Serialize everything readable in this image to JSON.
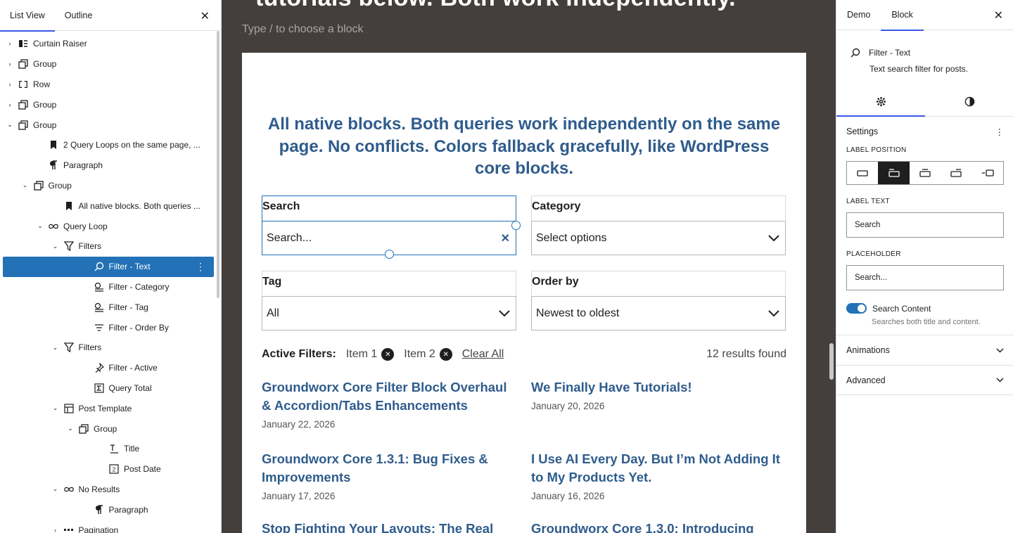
{
  "left_panel": {
    "tabs": [
      "List View",
      "Outline"
    ],
    "close_label": "✕",
    "tree": [
      {
        "label": "Curtain Raiser",
        "chev": "›",
        "indent": 0,
        "icon": "curtain-icon"
      },
      {
        "label": "Group",
        "chev": "›",
        "indent": 0,
        "icon": "group-icon"
      },
      {
        "label": "Row",
        "chev": "›",
        "indent": 0,
        "icon": "row-icon"
      },
      {
        "label": "Group",
        "chev": "›",
        "indent": 0,
        "icon": "group-icon"
      },
      {
        "label": "Group",
        "chev": "⌄",
        "indent": 0,
        "icon": "group-icon"
      },
      {
        "label": "2 Query Loops on the same page, ...",
        "chev": "",
        "indent": 2,
        "icon": "bookmark-icon"
      },
      {
        "label": "Paragraph",
        "chev": "",
        "indent": 2,
        "icon": "paragraph-icon"
      },
      {
        "label": "Group",
        "chev": "⌄",
        "indent": 1,
        "icon": "group-icon"
      },
      {
        "label": "All native blocks. Both queries ...",
        "chev": "",
        "indent": 3,
        "icon": "bookmark-icon"
      },
      {
        "label": "Query Loop",
        "chev": "⌄",
        "indent": 2,
        "icon": "loop-icon"
      },
      {
        "label": "Filters",
        "chev": "⌄",
        "indent": 3,
        "icon": "funnel-icon"
      },
      {
        "label": "Filter - Text",
        "chev": "",
        "indent": 5,
        "icon": "search-icon",
        "selected": true
      },
      {
        "label": "Filter - Category",
        "chev": "",
        "indent": 5,
        "icon": "filter-select-icon"
      },
      {
        "label": "Filter - Tag",
        "chev": "",
        "indent": 5,
        "icon": "filter-select-icon"
      },
      {
        "label": "Filter - Order By",
        "chev": "",
        "indent": 5,
        "icon": "sort-icon"
      },
      {
        "label": "Filters",
        "chev": "⌄",
        "indent": 3,
        "icon": "funnel-icon"
      },
      {
        "label": "Filter - Active",
        "chev": "",
        "indent": 5,
        "icon": "pin-icon"
      },
      {
        "label": "Query Total",
        "chev": "",
        "indent": 5,
        "icon": "sigma-icon"
      },
      {
        "label": "Post Template",
        "chev": "⌄",
        "indent": 3,
        "icon": "template-icon"
      },
      {
        "label": "Group",
        "chev": "⌄",
        "indent": 4,
        "icon": "group-icon"
      },
      {
        "label": "Title",
        "chev": "",
        "indent": 6,
        "icon": "title-icon"
      },
      {
        "label": "Post Date",
        "chev": "",
        "indent": 6,
        "icon": "date-icon"
      },
      {
        "label": "No Results",
        "chev": "⌄",
        "indent": 3,
        "icon": "loop-icon"
      },
      {
        "label": "Paragraph",
        "chev": "",
        "indent": 5,
        "icon": "paragraph-icon"
      },
      {
        "label": "Pagination",
        "chev": "›",
        "indent": 3,
        "icon": "pagination-icon"
      }
    ]
  },
  "canvas": {
    "heading_fragment": "tutorials below. Both work independently.",
    "placeholder": "Type / to choose a block",
    "lead": "All native blocks. Both queries work independently on the same page. No conflicts. Colors fallback gracefully, like WordPress core blocks.",
    "filters": {
      "search": {
        "label": "Search",
        "placeholder": "Search...",
        "clear": "✕"
      },
      "category": {
        "label": "Category",
        "value": "Select options"
      },
      "tag": {
        "label": "Tag",
        "value": "All"
      },
      "order": {
        "label": "Order by",
        "value": "Newest to oldest"
      }
    },
    "active_filters": {
      "label": "Active Filters:",
      "items": [
        "Item 1",
        "Item 2"
      ],
      "clear": "Clear All",
      "results": "12 results found"
    },
    "posts": [
      {
        "title": "Groundworx Core Filter Block Overhaul & Accordion/Tabs Enhancements",
        "date": "January 22, 2026"
      },
      {
        "title": "We Finally Have Tutorials!",
        "date": "January 20, 2026"
      },
      {
        "title": "Groundworx Core 1.3.1: Bug Fixes & Improvements",
        "date": "January 17, 2026"
      },
      {
        "title": "I Use AI Every Day. But I’m Not Adding It to My Products Yet.",
        "date": "January 16, 2026"
      },
      {
        "title": "Stop Fighting Your Layouts: The Real",
        "date": ""
      },
      {
        "title": "Groundworx Core 1.3.0: Introducing",
        "date": ""
      }
    ]
  },
  "right_panel": {
    "tabs": [
      "Demo",
      "Block"
    ],
    "close_label": "✕",
    "block_title": "Filter - Text",
    "block_desc": "Text search filter for posts.",
    "settings_label": "Settings",
    "more_label": "⋮",
    "label_position_caption": "LABEL POSITION",
    "label_text_caption": "LABEL TEXT",
    "label_text_value": "Search",
    "placeholder_caption": "PLACEHOLDER",
    "placeholder_value": "Search...",
    "toggle_label": "Search Content",
    "toggle_help": "Searches both title and content.",
    "panels": [
      "Animations",
      "Advanced"
    ]
  },
  "colors": {
    "accent": "#2371b6",
    "heading_blue": "#2f5c8c",
    "canvas_bg": "#443f3c",
    "wp_blue": "#3858e9"
  }
}
